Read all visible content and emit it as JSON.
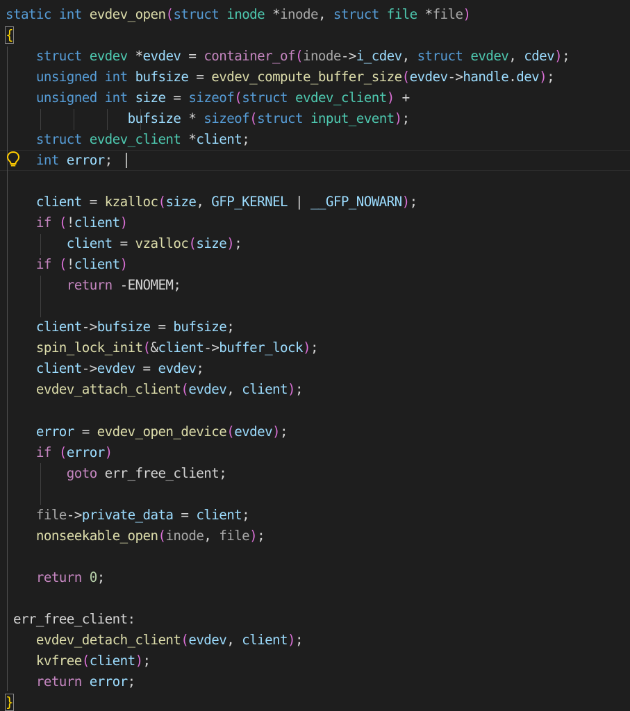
{
  "editor": {
    "function_name": "evdev_open",
    "lines": [
      "static int evdev_open(struct inode *inode, struct file *file)",
      "{",
      "    struct evdev *evdev = container_of(inode->i_cdev, struct evdev, cdev);",
      "    unsigned int bufsize = evdev_compute_buffer_size(evdev->handle.dev);",
      "    unsigned int size = sizeof(struct evdev_client) +",
      "                bufsize * sizeof(struct input_event);",
      "    struct evdev_client *client;",
      "    int error;",
      "",
      "    client = kzalloc(size, GFP_KERNEL | __GFP_NOWARN);",
      "    if (!client)",
      "        client = vzalloc(size);",
      "    if (!client)",
      "        return -ENOMEM;",
      "",
      "    client->bufsize = bufsize;",
      "    spin_lock_init(&client->buffer_lock);",
      "    client->evdev = evdev;",
      "    evdev_attach_client(evdev, client);",
      "",
      "    error = evdev_open_device(evdev);",
      "    if (error)",
      "        goto err_free_client;",
      "",
      "    file->private_data = client;",
      "    nonseekable_open(inode, file);",
      "",
      "    return 0;",
      "",
      " err_free_client:",
      "    evdev_detach_client(evdev, client);",
      "    kvfree(client);",
      "    return error;",
      "}"
    ]
  },
  "gutter": {
    "lightbulb_icon": "lightbulb-icon"
  },
  "colors": {
    "background": "#1e1e1e",
    "keyword": "#569cd6",
    "function": "#dcdcaa",
    "variable": "#9cdcfe",
    "type": "#4ec9b0",
    "control": "#c586c0",
    "number": "#b5cea8",
    "bracket_1": "#ffd700",
    "bracket_2": "#da70d6",
    "bracket_3": "#179fff",
    "lightbulb": "#ffcc00"
  }
}
